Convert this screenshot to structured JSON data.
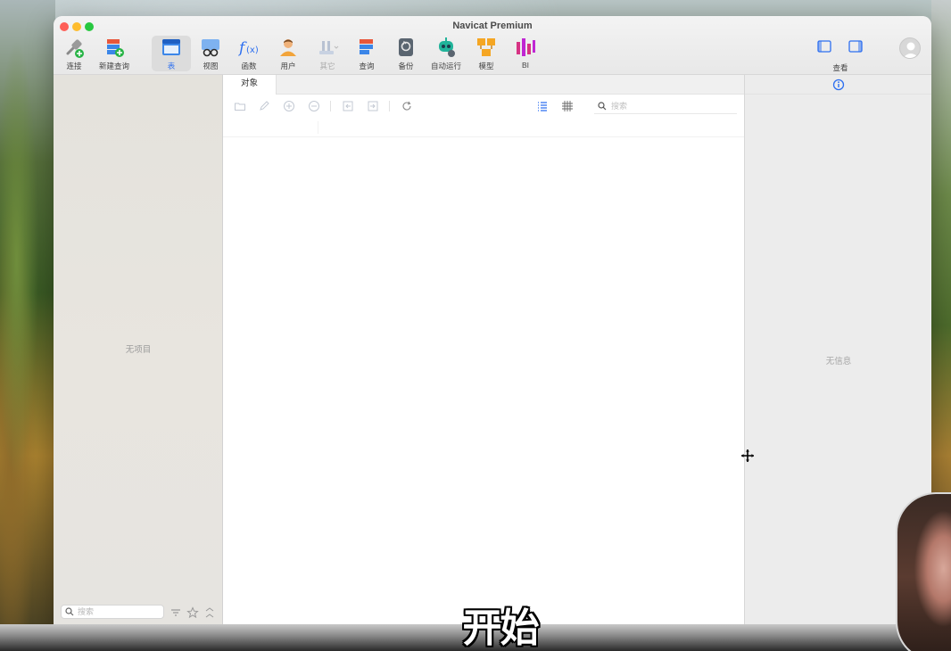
{
  "window": {
    "title": "Navicat Premium"
  },
  "toolbar": {
    "items": [
      {
        "label": "连接",
        "icon": "connection-plug-icon"
      },
      {
        "label": "新建查询",
        "icon": "new-query-icon"
      },
      {
        "label": "表",
        "icon": "table-icon",
        "active": true
      },
      {
        "label": "视图",
        "icon": "view-glasses-icon"
      },
      {
        "label": "函数",
        "icon": "function-fx-icon"
      },
      {
        "label": "用户",
        "icon": "user-icon"
      },
      {
        "label": "其它",
        "icon": "other-tools-icon",
        "disabled": true
      },
      {
        "label": "查询",
        "icon": "query-icon"
      },
      {
        "label": "备份",
        "icon": "backup-icon"
      },
      {
        "label": "自动运行",
        "icon": "automation-robot-icon"
      },
      {
        "label": "模型",
        "icon": "model-icon"
      },
      {
        "label": "BI",
        "icon": "bi-chart-icon"
      }
    ],
    "view_label": "查看"
  },
  "sidebar": {
    "empty_text": "无项目",
    "search_placeholder": "搜索"
  },
  "main": {
    "tab_label": "对象",
    "search_placeholder": "搜索"
  },
  "inspector": {
    "empty_text": "无信息"
  },
  "subtitle": "开始",
  "colors": {
    "accent": "#2d6ff0",
    "close": "#fe5f57",
    "minimize": "#febc2e",
    "maximize": "#28c840"
  }
}
